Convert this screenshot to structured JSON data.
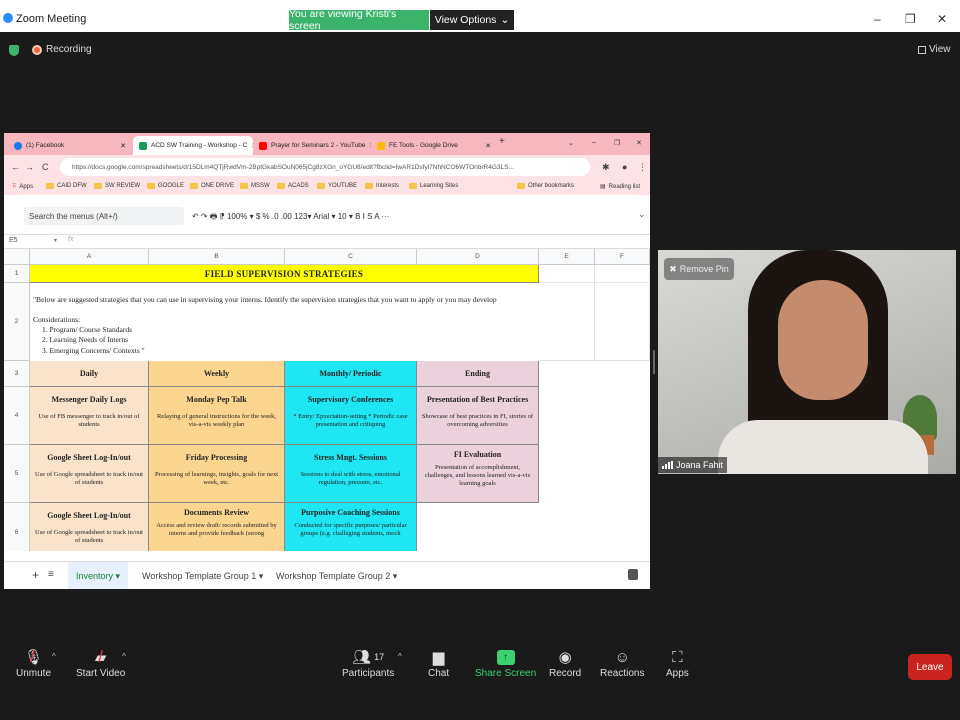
{
  "window": {
    "title": "Zoom Meeting",
    "viewing_banner": "You are viewing Kristi's screen",
    "view_options": "View Options"
  },
  "meeting": {
    "recording_label": "Recording",
    "view_label": "View"
  },
  "browser": {
    "tabs": [
      {
        "label": "(1) Facebook",
        "color": "#1877f2"
      },
      {
        "label": "ACD SW Training - Workshop - C",
        "color": "#0f9d58"
      },
      {
        "label": "Prayer for Seminars 2 - YouTube",
        "color": "#ff0000"
      },
      {
        "label": "FE Tools - Google Drive",
        "color": "#fbbc04"
      }
    ],
    "url": "https://docs.google.com/spreadsheets/d/15DLm4QTjRwdVm-2BptGkabSOuN065jCg8zXGn_oYGU8/edit?fbclid=IwAR1Dsfyl7NhNCO6WTOnbrR4G3LS...",
    "bookmarks": [
      "Apps",
      "CAID DFW",
      "SW REVIEW",
      "GOOGLE",
      "ONE DRIVE",
      "MSSW",
      "ACADS",
      "YOUTUBE",
      "Interests",
      "Learning Sites",
      "Other bookmarks",
      "Reading list"
    ]
  },
  "sheet": {
    "menu_search_placeholder": "Search the menus (Alt+/)",
    "tools_text": "↶  ↷  🖶  ⁋    100%  ▾    $    %   .0   .00   123▾    Arial         ▾     10     ▾    B   I   S   A     ···",
    "cell_ref": "E5",
    "fx": "fx",
    "columns": [
      "A",
      "B",
      "C",
      "D",
      "E",
      "F"
    ],
    "rows": [
      "1",
      "2",
      "3",
      "4",
      "5",
      "6"
    ],
    "title": "FIELD SUPERVISION STRATEGIES",
    "intro_line": "\"Below are suggested strategies that you can use in supervising your interns. Identify the supervision strategies that you want to apply or you may develop",
    "considerations": "Considerations:",
    "consider_items": [
      "1. Program/ Course Standards",
      "2. Learning Needs of Interns",
      "3. Emerging Concerns/ Contexts \""
    ],
    "headers": [
      "Daily",
      "Weekly",
      "Monthly/ Periodic",
      "Ending"
    ],
    "row4": [
      {
        "h": "Messenger Daily Logs",
        "d": "Use of FB messenger to track in/out of students"
      },
      {
        "h": "Monday Pep Talk",
        "d": "Relaying of general instructions for the week, vis-a-vis weekly plan"
      },
      {
        "h": "Supervisory Conferences",
        "d": "* Entry/ Epxectation-setting * Periodic case presentation and critiquing"
      },
      {
        "h": "Presentation of Best Practices",
        "d": "Showcase of best practices in FI, stories of overcoming adversities"
      }
    ],
    "row5": [
      {
        "h": "Google Sheet Log-In/out",
        "d": "Use of Google spreadsheet to track in/out of students"
      },
      {
        "h": "Friday Processing",
        "d": "Processing of learnings, insights, goals for next week, etc."
      },
      {
        "h": "Stress Mngt. Sessions",
        "d": "Sessions to deal with stress, emotional regulation, pressure, etc."
      },
      {
        "h": "FI Evaluation",
        "d": "Presentation of accomplishment, challenges, and lessons learned vis-a-vis learning goals"
      }
    ],
    "row6": [
      {
        "h": "Google Sheet Log-In/out",
        "d": "Use of Google spreadsheet to track in/out of students"
      },
      {
        "h": "Documents Review",
        "d": "Access and review draft/ records submitted by interns and provide feedback (strong"
      },
      {
        "h": "Purposive Coaching Sessions",
        "d": "Conducted for specific purposes/ particular groups (e.g. challeging students, mock"
      }
    ],
    "sheet_tabs": [
      "Inventory ▾",
      "Workshop Template Group 1 ▾",
      "Workshop Template Group 2 ▾"
    ]
  },
  "participant": {
    "name": "Joana Fahit",
    "remove_pin": "Remove Pin"
  },
  "toolbar": {
    "unmute": "Unmute",
    "start_video": "Start Video",
    "participants": "Participants",
    "participants_count": "17",
    "chat": "Chat",
    "share_screen": "Share Screen",
    "record": "Record",
    "reactions": "Reactions",
    "apps": "Apps",
    "leave": "Leave"
  }
}
